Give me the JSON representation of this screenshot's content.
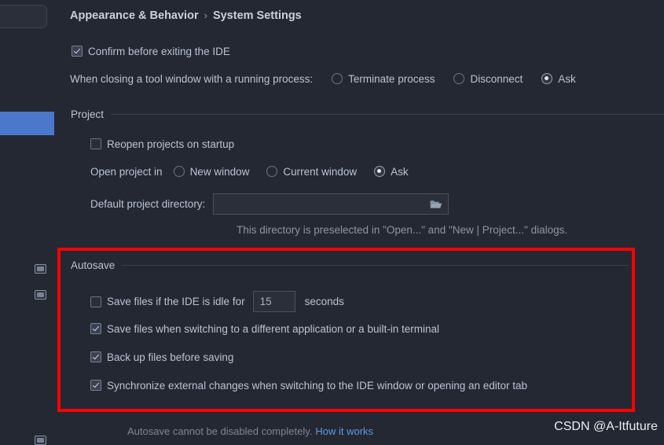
{
  "breadcrumb": {
    "parent": "Appearance & Behavior",
    "separator": "›",
    "current": "System Settings"
  },
  "general": {
    "confirm_exit_label": "Confirm before exiting the IDE",
    "confirm_exit_checked": true,
    "closing_tool_label": "When closing a tool window with a running process:",
    "closing_tool_options": [
      {
        "label": "Terminate process",
        "selected": false
      },
      {
        "label": "Disconnect",
        "selected": false
      },
      {
        "label": "Ask",
        "selected": true
      }
    ]
  },
  "project": {
    "section_title": "Project",
    "reopen_label": "Reopen projects on startup",
    "reopen_checked": false,
    "open_project_in_label": "Open project in",
    "open_project_in_options": [
      {
        "label": "New window",
        "selected": false
      },
      {
        "label": "Current window",
        "selected": false
      },
      {
        "label": "Ask",
        "selected": true
      }
    ],
    "default_dir_label": "Default project directory:",
    "default_dir_value": "",
    "default_dir_placeholder": "",
    "folder_icon": "folder-open-icon",
    "dir_hint": "This directory is preselected in \"Open...\" and \"New | Project...\" dialogs."
  },
  "autosave": {
    "section_title": "Autosave",
    "idle_label": "Save files if the IDE is idle for",
    "idle_checked": false,
    "idle_seconds": "15",
    "idle_unit": "seconds",
    "items": [
      {
        "label": "Save files when switching to a different application or a built-in terminal",
        "checked": true
      },
      {
        "label": "Back up files before saving",
        "checked": true
      },
      {
        "label": "Synchronize external changes when switching to the IDE window or opening an editor tab",
        "checked": true
      }
    ]
  },
  "footer": {
    "note": "Autosave cannot be disabled completely.",
    "link_label": "How it works"
  },
  "watermark": "CSDN @A-Itfuture",
  "annotation": {
    "highlight_color": "#FF0000"
  },
  "sidebar": {
    "search_placeholder": "",
    "rail_icons": [
      "window-icon",
      "window-icon",
      "window-icon"
    ]
  },
  "colors": {
    "background": "#242832",
    "selection_blue": "#4C78CC",
    "link_blue": "#5C9BE0",
    "annotation_red": "#FF0000"
  }
}
